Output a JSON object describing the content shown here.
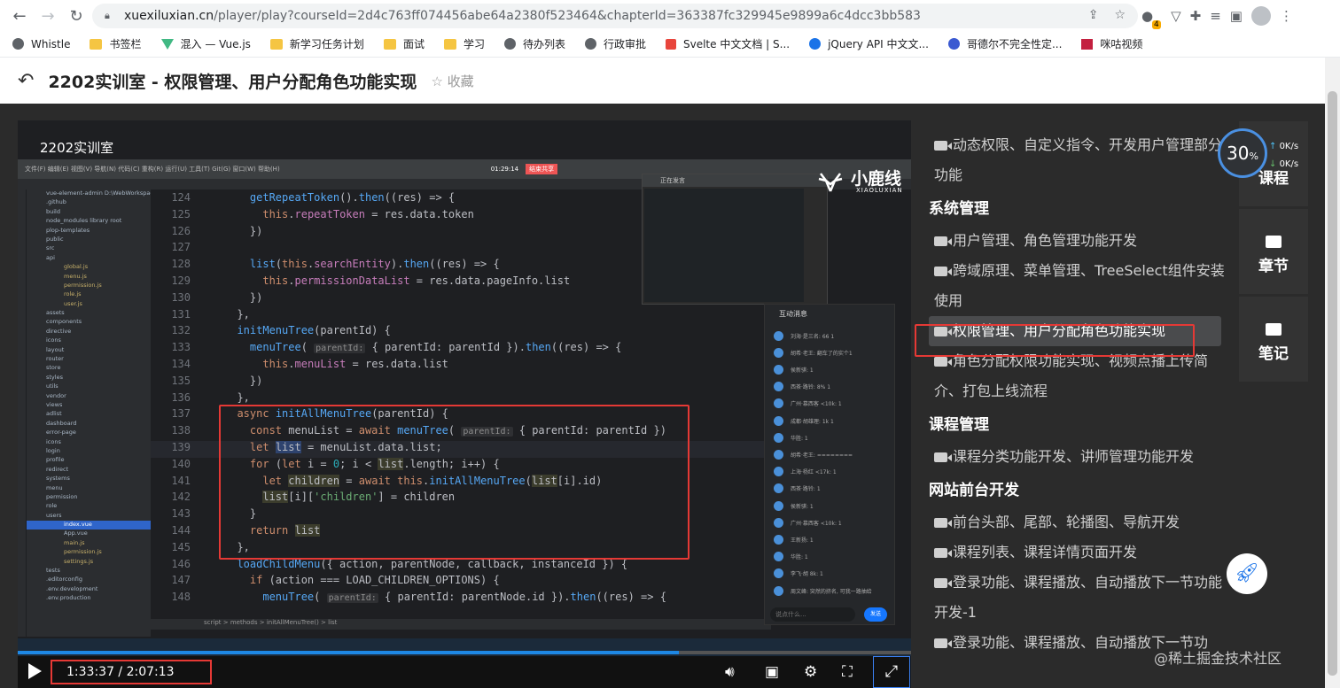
{
  "browser": {
    "url_host": "xuexiluxian.cn",
    "url_path": "/player/play?courseId=2d4c763ff074456abe64a2380f523464&chapterId=363387fc329945e9899a6c4dcc3bb583",
    "ext_badge": "4"
  },
  "bookmarks": [
    {
      "label": "Whistle",
      "icon": "whistle-icon"
    },
    {
      "label": "书签栏",
      "icon": "folder-icon"
    },
    {
      "label": "混入 — Vue.js",
      "icon": "vue-icon"
    },
    {
      "label": "新学习任务计划",
      "icon": "folder-icon"
    },
    {
      "label": "面试",
      "icon": "folder-icon"
    },
    {
      "label": "学习",
      "icon": "folder-icon"
    },
    {
      "label": "待办列表",
      "icon": "globe-icon"
    },
    {
      "label": "行政审批",
      "icon": "globe-icon"
    },
    {
      "label": "Svelte 中文文档 | S...",
      "icon": "svelte-icon"
    },
    {
      "label": "jQuery API 中文文...",
      "icon": "jquery-icon"
    },
    {
      "label": "哥德尔不完全性定...",
      "icon": "paw-icon"
    },
    {
      "label": "咪咕视频",
      "icon": "migu-icon"
    }
  ],
  "header": {
    "title": "2202实训室 - 权限管理、用户分配角色功能实现",
    "favorite": "☆ 收藏"
  },
  "video": {
    "overlay_title": "2202实训室",
    "ide_time": "01:29:14",
    "ide_stop": "结束共享",
    "logo_cn": "小鹿线",
    "logo_en": "XIAOLUXIAN",
    "float_title": "正在发言",
    "project": "vue-element-admin",
    "breadcrumb": "script  >  methods  >  initAllMenuTree()  >  list",
    "chat_title": "互动消息",
    "chat_input_placeholder": "说点什么...",
    "chat_send": "发送",
    "chat_rows": [
      "刘海·是三名: 66 1",
      "胡希·老王: 翻车了的实个1",
      "侯新骐: 1",
      "西茶·路铃: 8% 1",
      "广州·慕西客 <10k: 1",
      "成都·胡雄理: 1k 1",
      "华胜: 1",
      "胡希·老王: ========",
      "上海·杨红 <17k: 1",
      "西茶·路铃: 1",
      "侯新骐: 1",
      "广州·慕西客 <10k: 1",
      "王新扬: 1",
      "华胜: 1",
      "李飞·胡 8k: 1",
      "周文峰: 突然的挤名, 可我一路抽给"
    ],
    "tree": [
      "vue-element-admin  D:\\WebWorkspace",
      ".github",
      "build",
      "node_modules library root",
      "plop-templates",
      "public",
      "src",
      "api",
      "global.js",
      "menu.js",
      "permission.js",
      "role.js",
      "user.js",
      "assets",
      "components",
      "directive",
      "icons",
      "layout",
      "router",
      "store",
      "styles",
      "utils",
      "vendor",
      "views",
      "adlist",
      "dashboard",
      "error-page",
      "icons",
      "login",
      "profile",
      "redirect",
      "systems",
      "menu",
      "permission",
      "role",
      "users",
      "index.vue",
      "App.vue",
      "main.js",
      "permission.js",
      "settings.js",
      "tests",
      ".editorconfig",
      ".env.development",
      ".env.production"
    ],
    "code_lines": [
      {
        "n": "124",
        "html": "    <span class=\"fn\">getRepeatToken</span>().<span class=\"fn\">then</span>((res) => {"
      },
      {
        "n": "125",
        "html": "      <span class=\"kw\">this</span>.<span class=\"pr\">repeatToken</span> = res.data.token"
      },
      {
        "n": "126",
        "html": "    })"
      },
      {
        "n": "127",
        "html": ""
      },
      {
        "n": "128",
        "html": "    <span class=\"fn\">list</span>(<span class=\"kw\">this</span>.<span class=\"pr\">searchEntity</span>).<span class=\"fn\">then</span>((res) => {"
      },
      {
        "n": "129",
        "html": "      <span class=\"kw\">this</span>.<span class=\"pr\">permissionDataList</span> = res.data.pageInfo.list"
      },
      {
        "n": "130",
        "html": "    })"
      },
      {
        "n": "131",
        "html": "  },"
      },
      {
        "n": "132",
        "html": "  <span class=\"fn\">initMenuTree</span>(parentId) {"
      },
      {
        "n": "133",
        "html": "    <span class=\"fn\">menuTree</span>( <span class=\"hint\">parentId:</span> { parentId: parentId }).<span class=\"fn\">then</span>((res) => {"
      },
      {
        "n": "134",
        "html": "      <span class=\"kw\">this</span>.<span class=\"pr\">menuList</span> = res.data.list"
      },
      {
        "n": "135",
        "html": "    })"
      },
      {
        "n": "136",
        "html": "  },"
      },
      {
        "n": "137",
        "html": "  <span class=\"kw\">async</span> <span class=\"fn\">initAllMenuTree</span>(parentId) {"
      },
      {
        "n": "138",
        "html": "    <span class=\"kw\">const</span> menuList = <span class=\"kw\">await</span> <span class=\"fn\">menuTree</span>( <span class=\"hint\">parentId:</span> { parentId: parentId })"
      },
      {
        "n": "139",
        "html": "    <span class=\"kw\">let</span> <span class=\"hl\">list</span> = menuList.data.list;"
      },
      {
        "n": "140",
        "html": "    <span class=\"kw\">for</span> (<span class=\"kw\">let</span> i = <span class=\"num\">0</span>; i &lt; <span class=\"hl2\">list</span>.length; i++) {"
      },
      {
        "n": "141",
        "html": "      <span class=\"kw\">let</span> <span class=\"hl2\">children</span> = <span class=\"kw\">await</span> <span class=\"kw\">this</span>.<span class=\"fn\">initAllMenuTree</span>(<span class=\"hl2\">list</span>[i].id)"
      },
      {
        "n": "142",
        "html": "      <span class=\"hl2\">list</span>[i][<span class=\"str\">'children'</span>] = children"
      },
      {
        "n": "143",
        "html": "    }"
      },
      {
        "n": "144",
        "html": "    <span class=\"kw\">return</span> <span class=\"hl2\">list</span>"
      },
      {
        "n": "145",
        "html": "  },"
      },
      {
        "n": "146",
        "html": "  <span class=\"fn\">loadChildMenu</span>({ action, parentNode, callback, instanceId }) {"
      },
      {
        "n": "147",
        "html": "    <span class=\"kw\">if</span> (action === LOAD_CHILDREN_OPTIONS) {"
      },
      {
        "n": "148",
        "html": "      <span class=\"fn\">menuTree</span>( <span class=\"hint\">parentId:</span> { parentId: parentNode.id }).<span class=\"fn\">then</span>((res) => {"
      }
    ]
  },
  "player": {
    "time": "1:33:37 / 2:07:13",
    "progress": 0.74
  },
  "chapters": [
    {
      "type": "item",
      "label": "动态权限、自定义指令、开发用户管理部分功能"
    },
    {
      "type": "head",
      "label": "系统管理"
    },
    {
      "type": "item",
      "label": "用户管理、角色管理功能开发"
    },
    {
      "type": "item",
      "label": "跨域原理、菜单管理、TreeSelect组件安装使用"
    },
    {
      "type": "item",
      "label": "权限管理、用户分配角色功能实现",
      "active": true
    },
    {
      "type": "item",
      "label": "角色分配权限功能实现、视频点播上传简介、打包上线流程"
    },
    {
      "type": "head",
      "label": "课程管理"
    },
    {
      "type": "item",
      "label": "课程分类功能开发、讲师管理功能开发"
    },
    {
      "type": "head",
      "label": "网站前台开发"
    },
    {
      "type": "item",
      "label": "前台头部、尾部、轮播图、导航开发"
    },
    {
      "type": "item",
      "label": "课程列表、课程详情页面开发"
    },
    {
      "type": "item",
      "label": "登录功能、课程播放、自动播放下一节功能开发-1"
    },
    {
      "type": "item",
      "label": "登录功能、课程播放、自动播放下一节功"
    }
  ],
  "side_tabs": {
    "course": "课程",
    "chapter": "章节",
    "notes": "笔记"
  },
  "speed": {
    "percent": "30",
    "unit": "%",
    "up": "0K/s",
    "down": "0K/s"
  },
  "watermark": "@稀土掘金技术社区"
}
